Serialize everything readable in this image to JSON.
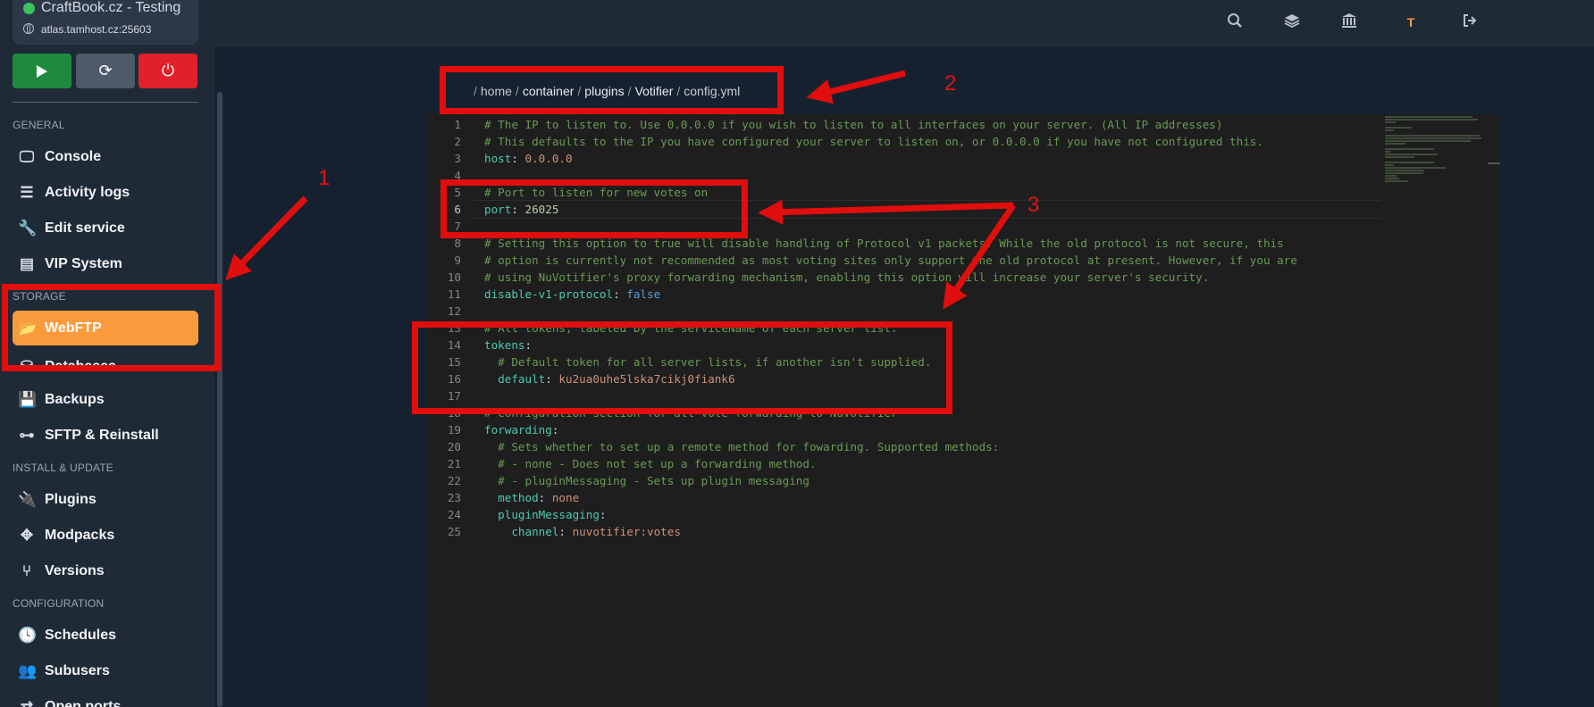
{
  "header": {
    "server_name": "CraftBook.cz - Testing",
    "server_address": "atlas.tamhost.cz:25603",
    "icons": [
      "search-icon",
      "layers-icon",
      "bank-icon",
      "user-t-icon",
      "logout-icon"
    ],
    "user_initial": "T",
    "user_color": "#f99b3c"
  },
  "power": {
    "start_icon": "play-icon",
    "restart_icon": "refresh-icon",
    "stop_icon": "power-icon"
  },
  "sidebar": {
    "sections": [
      "GENERAL",
      "STORAGE",
      "INSTALL & UPDATE",
      "CONFIGURATION"
    ],
    "items": [
      {
        "label": "Console",
        "icon": "monitor-icon"
      },
      {
        "label": "Activity logs",
        "icon": "list-icon"
      },
      {
        "label": "Edit service",
        "icon": "wrench-icon"
      },
      {
        "label": "VIP System",
        "icon": "store-icon"
      },
      {
        "label": "WebFTP",
        "icon": "folder-open-icon",
        "active": true
      },
      {
        "label": "Databases",
        "icon": "database-icon"
      },
      {
        "label": "Backups",
        "icon": "save-icon"
      },
      {
        "label": "SFTP & Reinstall",
        "icon": "sitemap-icon"
      },
      {
        "label": "Plugins",
        "icon": "plug-icon"
      },
      {
        "label": "Modpacks",
        "icon": "puzzle-icon"
      },
      {
        "label": "Versions",
        "icon": "branch-icon"
      },
      {
        "label": "Schedules",
        "icon": "clock-icon"
      },
      {
        "label": "Subusers",
        "icon": "users-icon"
      },
      {
        "label": "Open ports",
        "icon": "network-icon"
      }
    ],
    "active_color": "#f99b3c"
  },
  "breadcrumb": [
    "/",
    "home",
    "/",
    "container",
    "/",
    "plugins",
    "/",
    "Votifier",
    "/",
    "config.yml"
  ],
  "editor": {
    "current_line": 6,
    "lines": [
      {
        "n": "1",
        "parts": [
          [
            "cm",
            "# The IP to listen to. Use 0.0.0.0 if you wish to listen to all interfaces on your server. (All IP addresses)"
          ]
        ]
      },
      {
        "n": "2",
        "parts": [
          [
            "cm",
            "# This defaults to the IP you have configured your server to listen on, or 0.0.0.0 if you have not configured this."
          ]
        ]
      },
      {
        "n": "3",
        "parts": [
          [
            "key",
            "host"
          ],
          [
            "pun",
            ": "
          ],
          [
            "val",
            "0.0.0.0"
          ]
        ]
      },
      {
        "n": "4",
        "parts": []
      },
      {
        "n": "5",
        "parts": [
          [
            "cm",
            "# Port to listen for new votes on"
          ]
        ]
      },
      {
        "n": "6",
        "parts": [
          [
            "key",
            "port"
          ],
          [
            "pun",
            ": "
          ],
          [
            "num",
            "26025"
          ]
        ]
      },
      {
        "n": "7",
        "parts": []
      },
      {
        "n": "8",
        "parts": [
          [
            "cm",
            "# Setting this option to true will disable handling of Protocol v1 packets. While the old protocol is not secure, this"
          ]
        ]
      },
      {
        "n": "9",
        "parts": [
          [
            "cm",
            "# option is currently not recommended as most voting sites only support the old protocol at present. However, if you are"
          ]
        ]
      },
      {
        "n": "10",
        "parts": [
          [
            "cm",
            "# using NuVotifier's proxy forwarding mechanism, enabling this option will increase your server's security."
          ]
        ]
      },
      {
        "n": "11",
        "parts": [
          [
            "key",
            "disable-v1-protocol"
          ],
          [
            "pun",
            ": "
          ],
          [
            "bool",
            "false"
          ]
        ]
      },
      {
        "n": "12",
        "parts": []
      },
      {
        "n": "13",
        "parts": [
          [
            "cm",
            "# All tokens, labeled by the serviceName of each server list."
          ]
        ]
      },
      {
        "n": "14",
        "parts": [
          [
            "key",
            "tokens"
          ],
          [
            "pun",
            ":"
          ]
        ]
      },
      {
        "n": "15",
        "parts": [
          [
            "pun",
            "  "
          ],
          [
            "cm",
            "# Default token for all server lists, if another isn't supplied."
          ]
        ]
      },
      {
        "n": "16",
        "parts": [
          [
            "pun",
            "  "
          ],
          [
            "key",
            "default"
          ],
          [
            "pun",
            ": "
          ],
          [
            "val",
            "ku2ua0uhe5lska7cikj0fiank6"
          ]
        ]
      },
      {
        "n": "17",
        "parts": []
      },
      {
        "n": "18",
        "parts": [
          [
            "cm",
            "# Configuration section for all vote forwarding to NuVotifier"
          ]
        ]
      },
      {
        "n": "19",
        "parts": [
          [
            "key",
            "forwarding"
          ],
          [
            "pun",
            ":"
          ]
        ]
      },
      {
        "n": "20",
        "parts": [
          [
            "pun",
            "  "
          ],
          [
            "cm",
            "# Sets whether to set up a remote method for fowarding. Supported methods:"
          ]
        ]
      },
      {
        "n": "21",
        "parts": [
          [
            "pun",
            "  "
          ],
          [
            "cm",
            "# - none - Does not set up a forwarding method."
          ]
        ]
      },
      {
        "n": "22",
        "parts": [
          [
            "pun",
            "  "
          ],
          [
            "cm",
            "# - pluginMessaging - Sets up plugin messaging"
          ]
        ]
      },
      {
        "n": "23",
        "parts": [
          [
            "pun",
            "  "
          ],
          [
            "key",
            "method"
          ],
          [
            "pun",
            ": "
          ],
          [
            "val",
            "none"
          ]
        ]
      },
      {
        "n": "24",
        "parts": [
          [
            "pun",
            "  "
          ],
          [
            "key",
            "pluginMessaging"
          ],
          [
            "pun",
            ":"
          ]
        ]
      },
      {
        "n": "25",
        "parts": [
          [
            "pun",
            "    "
          ],
          [
            "key",
            "channel"
          ],
          [
            "pun",
            ": "
          ],
          [
            "val",
            "nuvotifier:votes"
          ]
        ]
      }
    ]
  },
  "annotations": {
    "numbers": [
      "1",
      "2",
      "3"
    ],
    "color": "#e10e0e"
  }
}
